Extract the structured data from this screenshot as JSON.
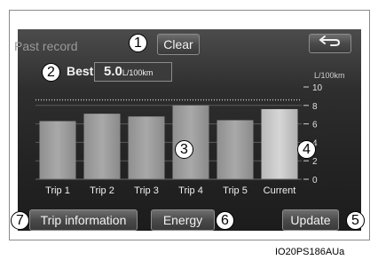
{
  "screen": {
    "title": "Past record",
    "clear_label": "Clear",
    "back_icon": "return-arrow-icon",
    "best_label": "Best",
    "best_value": "5.0",
    "best_unit": "L/100km",
    "unit_label": "L/100km"
  },
  "chart_data": {
    "type": "bar",
    "categories": [
      "Trip 1",
      "Trip 2",
      "Trip 3",
      "Trip 4",
      "Trip 5",
      "Current"
    ],
    "values": [
      6.3,
      7.1,
      6.8,
      8.0,
      6.4,
      7.6
    ],
    "ylim": [
      0,
      10
    ],
    "yticks": [
      "0",
      "2",
      "4",
      "6",
      "8",
      "10"
    ],
    "best_line": 8.6,
    "ylabel": "L/100km",
    "grid": true
  },
  "buttons": {
    "trip_info": "Trip information",
    "energy": "Energy",
    "update": "Update"
  },
  "callouts": [
    "1",
    "2",
    "3",
    "4",
    "5",
    "6",
    "7"
  ],
  "figure_id": "IO20PS186AUa",
  "colors": {
    "screen_bg": "#2e2e2e",
    "bar_normal": "#a9a9a9",
    "bar_current": "#d6d6d6"
  }
}
